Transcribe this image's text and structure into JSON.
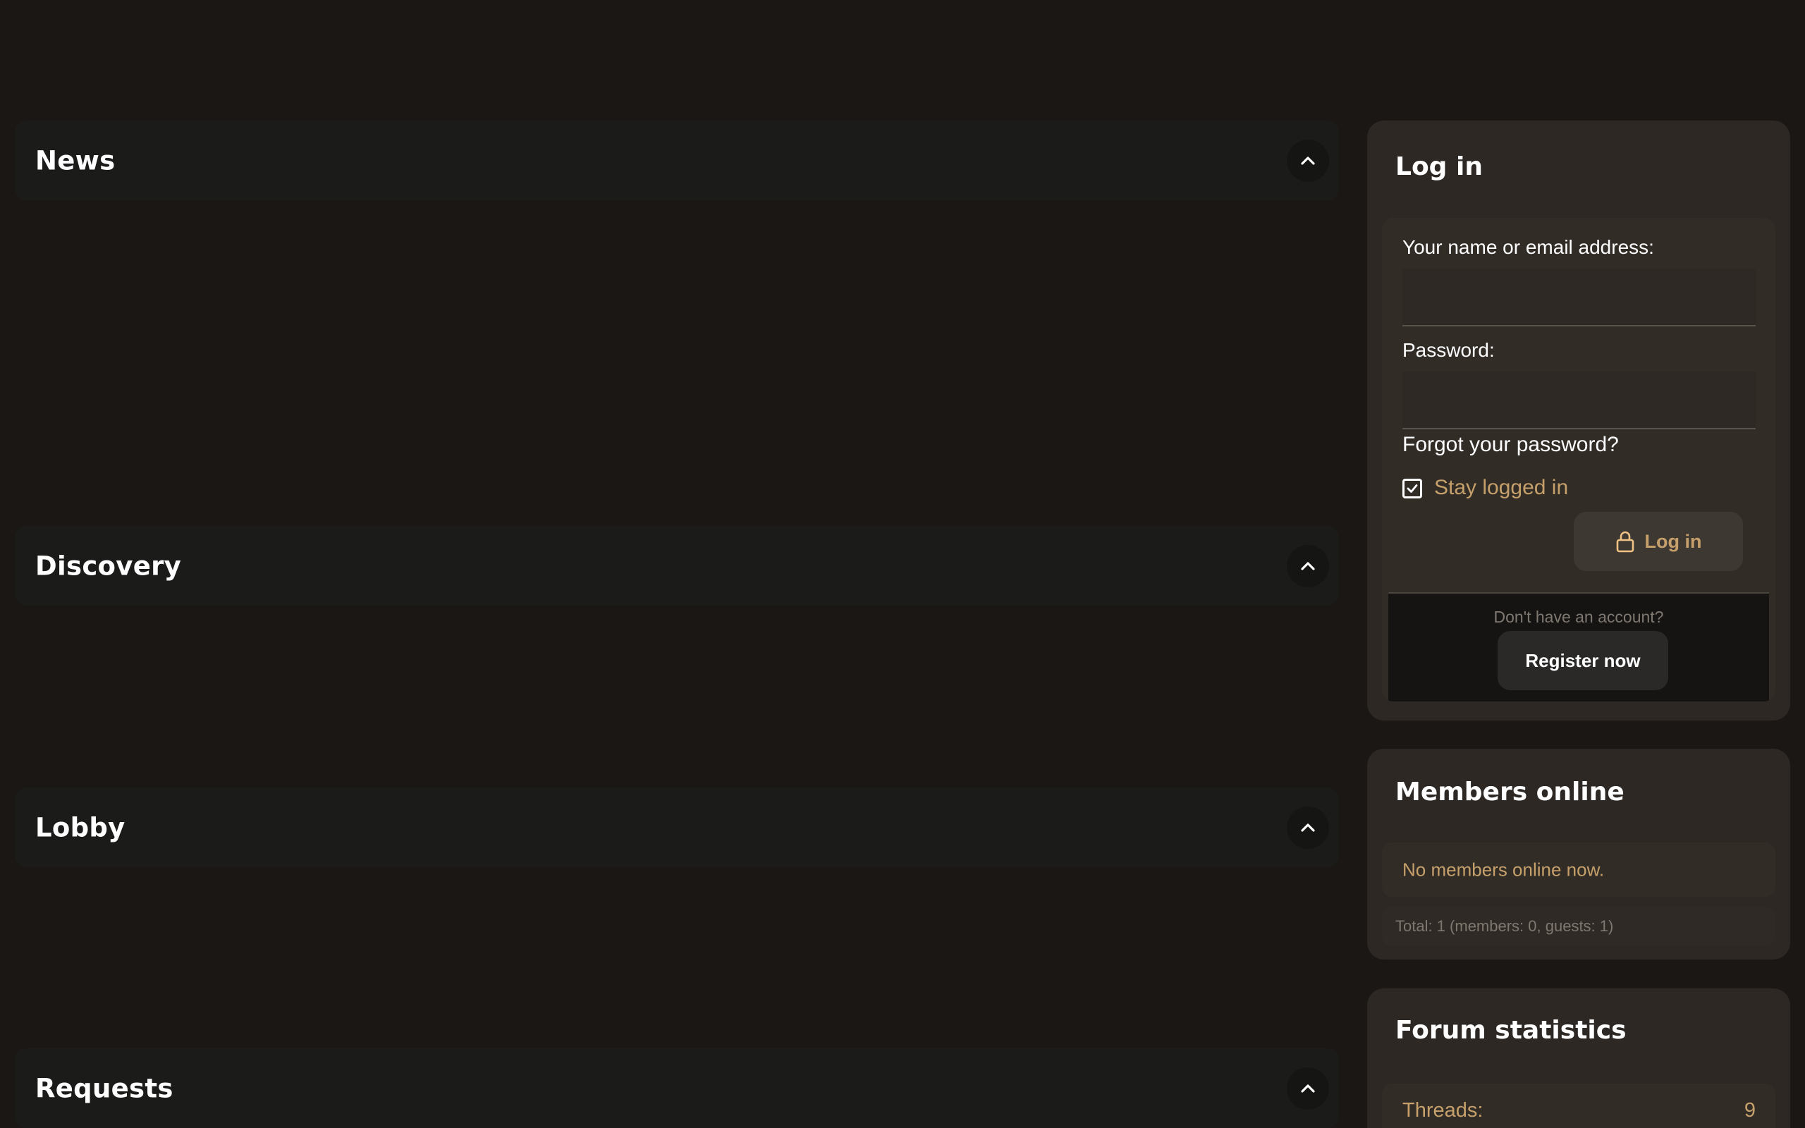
{
  "colors": {
    "background": "#1b1715",
    "category_card": "#1b1b1a",
    "sidebar_block": "#2d2824",
    "accent_gold": "#c6a06b",
    "muted_text": "#7f7870",
    "white_text": "#ffffff"
  },
  "categories": [
    {
      "title": "News",
      "toggle_icon": "chevron-up-icon"
    },
    {
      "title": "Discovery",
      "toggle_icon": "chevron-up-icon"
    },
    {
      "title": "Lobby",
      "toggle_icon": "chevron-up-icon"
    },
    {
      "title": "Requests",
      "toggle_icon": "chevron-up-icon"
    }
  ],
  "login": {
    "title": "Log in",
    "username_label": "Your name or email address:",
    "username_value": "",
    "password_label": "Password:",
    "password_value": "",
    "forgot_link": "Forgot your password?",
    "stay_logged_in_label": "Stay logged in",
    "stay_logged_in_checked": true,
    "submit_icon": "lock-icon",
    "submit_label": "Log in",
    "register_prompt": "Don't have an account?",
    "register_label": "Register now"
  },
  "members_online": {
    "title": "Members online",
    "status": "No members online now.",
    "total": "Total: 1 (members: 0, guests: 1)"
  },
  "forum_statistics": {
    "title": "Forum statistics",
    "rows": [
      {
        "label": "Threads:",
        "value": "9"
      }
    ]
  }
}
